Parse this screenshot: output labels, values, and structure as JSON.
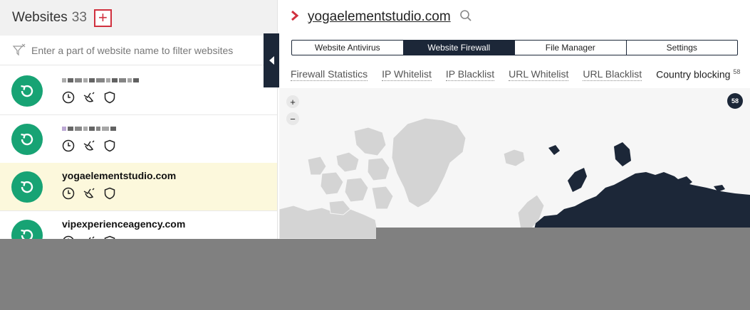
{
  "sidebar": {
    "title": "Websites",
    "count": "33",
    "add_label": "+",
    "filter_placeholder": "Enter a part of website name to filter websites",
    "sites": [
      {
        "name": "",
        "redacted": true
      },
      {
        "name": "",
        "redacted": true
      },
      {
        "name": "yogaelementstudio.com",
        "redacted": false,
        "selected": true
      },
      {
        "name": "vipexperienceagency.com",
        "redacted": false
      }
    ]
  },
  "site": {
    "title": "yogaelementstudio.com"
  },
  "main_tabs": [
    {
      "label": "Website Antivirus",
      "active": false
    },
    {
      "label": "Website Firewall",
      "active": true
    },
    {
      "label": "File Manager",
      "active": false
    },
    {
      "label": "Settings",
      "active": false
    }
  ],
  "sub_tabs": [
    {
      "label": "Firewall Statistics"
    },
    {
      "label": "IP Whitelist"
    },
    {
      "label": "IP Blacklist"
    },
    {
      "label": "URL Whitelist"
    },
    {
      "label": "URL Blacklist"
    },
    {
      "label": "Country blocking",
      "count": "58",
      "active": true
    }
  ],
  "map": {
    "zoom_in": "+",
    "zoom_out": "−",
    "blocked_count": "58"
  },
  "colors": {
    "status_green": "#17a374",
    "navy": "#1c2738",
    "accent_red": "#d0303e",
    "selected_row": "#fcf8dc"
  }
}
